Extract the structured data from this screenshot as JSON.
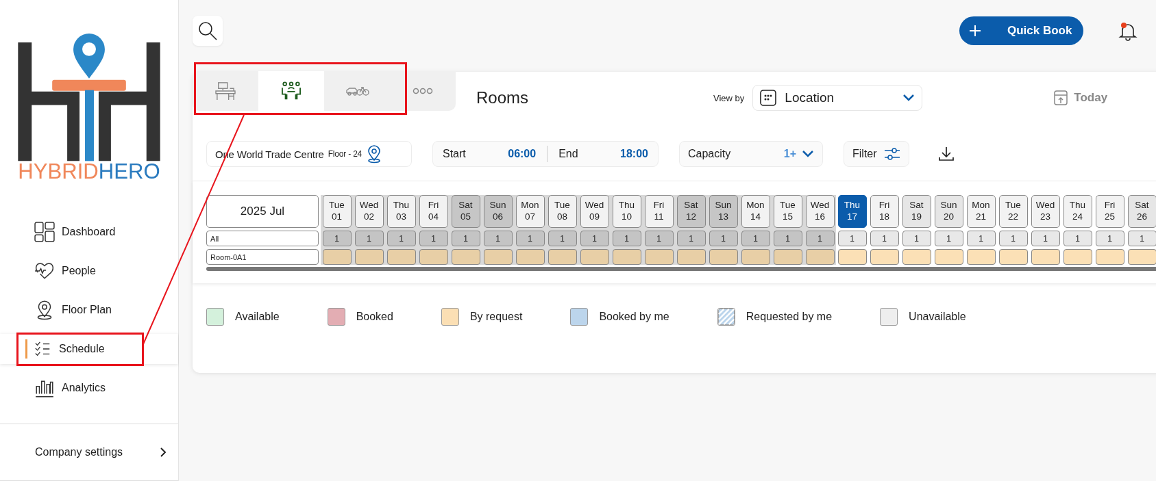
{
  "logo": {
    "wordmark_left": "HYBRID",
    "wordmark_right": "HERO"
  },
  "sidebar": {
    "items": [
      {
        "label": "Dashboard",
        "selected": false
      },
      {
        "label": "People",
        "selected": false
      },
      {
        "label": "Floor Plan",
        "selected": false
      },
      {
        "label": "Schedule",
        "selected": true
      },
      {
        "label": "Analytics",
        "selected": false
      }
    ],
    "company_settings": "Company settings"
  },
  "header": {
    "quick_book": "Quick Book",
    "notification_dot": true
  },
  "resource_tabs": [
    {
      "kind": "desk",
      "selected": false
    },
    {
      "kind": "room",
      "selected": true
    },
    {
      "kind": "vehicle",
      "selected": false
    },
    {
      "kind": "more",
      "selected": false
    }
  ],
  "title": "Rooms",
  "view_by_label": "View by",
  "view_by_value": "Location",
  "today": "Today",
  "filters": {
    "location": "One World Trade Centre",
    "floor": "Floor - 24",
    "start_label": "Start",
    "start": "06:00",
    "end_label": "End",
    "end": "18:00",
    "capacity_label": "Capacity",
    "capacity": "1+",
    "filter": "Filter"
  },
  "calendar": {
    "month": "2025 Jul",
    "row_labels": [
      "All",
      "Room-0A1"
    ],
    "days": [
      {
        "weekday": "Tue",
        "date": "01",
        "past": true,
        "weekend": false,
        "today": false,
        "count": "1"
      },
      {
        "weekday": "Wed",
        "date": "02",
        "past": true,
        "weekend": false,
        "today": false,
        "count": "1"
      },
      {
        "weekday": "Thu",
        "date": "03",
        "past": true,
        "weekend": false,
        "today": false,
        "count": "1"
      },
      {
        "weekday": "Fri",
        "date": "04",
        "past": true,
        "weekend": false,
        "today": false,
        "count": "1"
      },
      {
        "weekday": "Sat",
        "date": "05",
        "past": true,
        "weekend": true,
        "today": false,
        "count": "1"
      },
      {
        "weekday": "Sun",
        "date": "06",
        "past": true,
        "weekend": true,
        "today": false,
        "count": "1"
      },
      {
        "weekday": "Mon",
        "date": "07",
        "past": true,
        "weekend": false,
        "today": false,
        "count": "1"
      },
      {
        "weekday": "Tue",
        "date": "08",
        "past": true,
        "weekend": false,
        "today": false,
        "count": "1"
      },
      {
        "weekday": "Wed",
        "date": "09",
        "past": true,
        "weekend": false,
        "today": false,
        "count": "1"
      },
      {
        "weekday": "Thu",
        "date": "10",
        "past": true,
        "weekend": false,
        "today": false,
        "count": "1"
      },
      {
        "weekday": "Fri",
        "date": "11",
        "past": true,
        "weekend": false,
        "today": false,
        "count": "1"
      },
      {
        "weekday": "Sat",
        "date": "12",
        "past": true,
        "weekend": true,
        "today": false,
        "count": "1"
      },
      {
        "weekday": "Sun",
        "date": "13",
        "past": true,
        "weekend": true,
        "today": false,
        "count": "1"
      },
      {
        "weekday": "Mon",
        "date": "14",
        "past": true,
        "weekend": false,
        "today": false,
        "count": "1"
      },
      {
        "weekday": "Tue",
        "date": "15",
        "past": true,
        "weekend": false,
        "today": false,
        "count": "1"
      },
      {
        "weekday": "Wed",
        "date": "16",
        "past": true,
        "weekend": false,
        "today": false,
        "count": "1"
      },
      {
        "weekday": "Thu",
        "date": "17",
        "past": false,
        "weekend": false,
        "today": true,
        "count": "1"
      },
      {
        "weekday": "Fri",
        "date": "18",
        "past": false,
        "weekend": false,
        "today": false,
        "count": "1"
      },
      {
        "weekday": "Sat",
        "date": "19",
        "past": false,
        "weekend": true,
        "today": false,
        "count": "1"
      },
      {
        "weekday": "Sun",
        "date": "20",
        "past": false,
        "weekend": true,
        "today": false,
        "count": "1"
      },
      {
        "weekday": "Mon",
        "date": "21",
        "past": false,
        "weekend": false,
        "today": false,
        "count": "1"
      },
      {
        "weekday": "Tue",
        "date": "22",
        "past": false,
        "weekend": false,
        "today": false,
        "count": "1"
      },
      {
        "weekday": "Wed",
        "date": "23",
        "past": false,
        "weekend": false,
        "today": false,
        "count": "1"
      },
      {
        "weekday": "Thu",
        "date": "24",
        "past": false,
        "weekend": false,
        "today": false,
        "count": "1"
      },
      {
        "weekday": "Fri",
        "date": "25",
        "past": false,
        "weekend": false,
        "today": false,
        "count": "1"
      },
      {
        "weekday": "Sat",
        "date": "26",
        "past": false,
        "weekend": true,
        "today": false,
        "count": "1"
      }
    ]
  },
  "legend": [
    {
      "label": "Available",
      "color": "#d4f1dc",
      "kind": "solid"
    },
    {
      "label": "Booked",
      "color": "#e3adb3",
      "kind": "solid"
    },
    {
      "label": "By request",
      "color": "#fbdfb4",
      "kind": "solid"
    },
    {
      "label": "Booked by me",
      "color": "#bcd5ec",
      "kind": "solid"
    },
    {
      "label": "Requested by me",
      "color": "#bcd5ec",
      "kind": "hatched"
    },
    {
      "label": "Unavailable",
      "color": "#eeeeee",
      "kind": "solid"
    }
  ]
}
